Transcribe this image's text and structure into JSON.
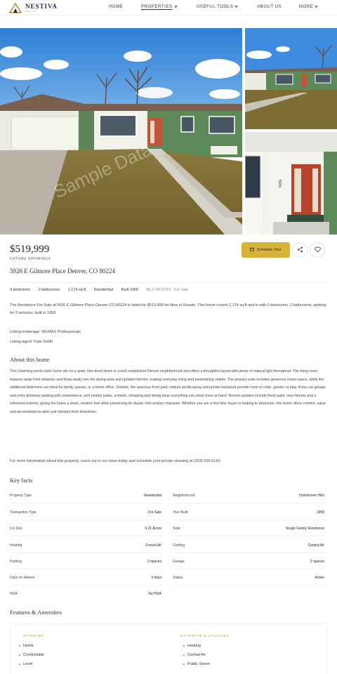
{
  "brand": {
    "name": "NESTIVA",
    "tagline": "REALTY"
  },
  "nav": {
    "items": [
      {
        "label": "HOME",
        "dropdown": false,
        "active": false
      },
      {
        "label": "PROPERTIES",
        "dropdown": true,
        "active": true
      },
      {
        "label": "USEFUL TOOLS",
        "dropdown": true,
        "active": false
      },
      {
        "label": "ABOUT US",
        "dropdown": false,
        "active": false
      },
      {
        "label": "MORE",
        "dropdown": true,
        "active": false
      }
    ]
  },
  "listing": {
    "price": "$519,999",
    "mls_label": "FUTURE SHOWINGS",
    "address": "5926 E Gilmore Place Denver, CO 80224",
    "schedule_label": "Schedule Tour",
    "facts": [
      "3 bedrooms",
      "2 bathrooms",
      "2,174 sq ft",
      "Residential",
      "Built 1958"
    ],
    "facts_dim": "MLS 5414763 · For Sale",
    "summary": "The Residence For Sale at 5926 E Gilmore Place Denver CO 80224 is listed for $519,999 for New or Resale. This home covers 2,174 sq ft and is with 3 bedrooms, 2 bathrooms, parking for 2 vehicles, built in 1958.",
    "listing_brokerage": "Listing brokerage: RE/MAX Professionals",
    "listing_agent": "Listing agent: Kate Smith",
    "about_title": "About this home",
    "about_body": "This charming ranch-style home sits on a quiet, tree-lined street in a well-established Denver neighborhood and offers a thoughtful layout with plenty of natural light throughout. The living room features large front windows and flows easily into the dining area and updated kitchen, making everyday living and entertaining simple. The primary suite includes generous closet space, while the additional bedrooms are ideal for family, guests, or a home office. Outside, the spacious front yard, mature landscaping and private backyard provide room to relax, garden or play. A two-car garage and extra driveway parking add convenience, and nearby parks, schools, shopping and dining keep everything you need close at hand. Recent updates include fresh paint, new fixtures and a refreshed exterior, giving the home a clean, modern feel while preserving its classic mid-century character. Whether you are a first-time buyer or looking to downsize, this home offers comfort, value and an excellent location just minutes from downtown.",
    "contact_line": "For more information about this property, reach out to our team today and schedule your private showing at (303) 555-0143.",
    "key_facts_title": "Key facts",
    "key_facts": [
      {
        "label": "Property Type",
        "value": "Residential"
      },
      {
        "label": "Neighborhood",
        "value": "Hutchinson Hills"
      },
      {
        "label": "Transaction Type",
        "value": "For Sale"
      },
      {
        "label": "Year Built",
        "value": "1958"
      },
      {
        "label": "Lot Size",
        "value": "0.21 Acres"
      },
      {
        "label": "Style",
        "value": "Single Family Residence"
      },
      {
        "label": "Heating",
        "value": "Forced Air"
      },
      {
        "label": "Cooling",
        "value": "Central Air"
      },
      {
        "label": "Parking",
        "value": "2 spaces"
      },
      {
        "label": "Garage",
        "value": "2 spaces"
      },
      {
        "label": "Days on Market",
        "value": "3 days"
      },
      {
        "label": "Status",
        "value": "Active"
      },
      {
        "label": "HOA",
        "value": "No HOA"
      }
    ],
    "features_title": "Features & Amenities",
    "features": {
      "left_heading": "INTERIOR",
      "left": [
        "Home",
        "Comfortable",
        "Level"
      ],
      "right_heading": "EXTERIOR & UTILITIES",
      "right": [
        "Heating",
        "Central Air",
        "Public Sewer"
      ]
    }
  },
  "colors": {
    "accent": "#d9b23a",
    "brand": "#1b2a44",
    "gold": "#b08d3c"
  }
}
